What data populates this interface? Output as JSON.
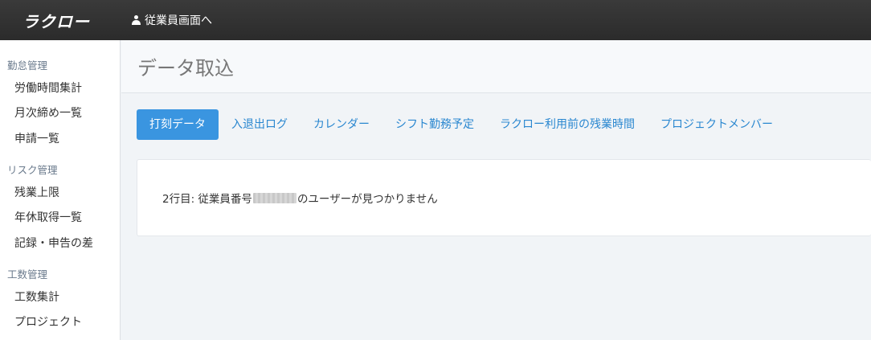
{
  "header": {
    "logo": "ラクロー",
    "employee_link": "従業員画面へ"
  },
  "sidebar": {
    "sections": [
      {
        "title": "勤怠管理",
        "items": [
          "労働時間集計",
          "月次締め一覧",
          "申請一覧"
        ]
      },
      {
        "title": "リスク管理",
        "items": [
          "残業上限",
          "年休取得一覧",
          "記録・申告の差"
        ]
      },
      {
        "title": "工数管理",
        "items": [
          "工数集計",
          "プロジェクト"
        ]
      }
    ]
  },
  "main": {
    "title": "データ取込",
    "tabs": [
      "打刻データ",
      "入退出ログ",
      "カレンダー",
      "シフト勤務予定",
      "ラクロー利用前の残業時間",
      "プロジェクトメンバー"
    ],
    "active_tab": 0,
    "message": {
      "prefix": "2行目: 従業員番号",
      "suffix": "のユーザーが見つかりません"
    }
  }
}
